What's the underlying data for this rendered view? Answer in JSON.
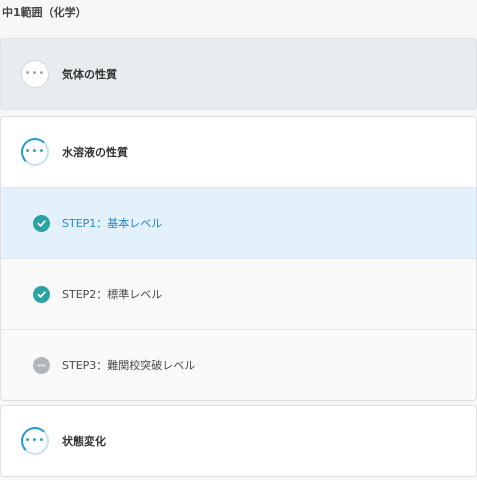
{
  "section_title": "中1範囲（化学）",
  "units": [
    {
      "title": "気体の性質",
      "icon": "more-dots-icon",
      "state": "collapsed"
    },
    {
      "title": "水溶液の性質",
      "icon": "progress-dots-icon",
      "state": "expanded",
      "steps": [
        {
          "label": "STEP1：基本レベル",
          "status": "completed",
          "icon": "check-circle-icon",
          "selected": true
        },
        {
          "label": "STEP2：標準レベル",
          "status": "completed",
          "icon": "check-circle-icon",
          "selected": false
        },
        {
          "label": "STEP3：難関校突破レベル",
          "status": "not-started",
          "icon": "more-dots-icon",
          "selected": false
        }
      ]
    },
    {
      "title": "状態変化",
      "icon": "progress-dots-icon",
      "state": "collapsed"
    }
  ],
  "colors": {
    "accent_blue": "#1f9bcf",
    "completed_teal": "#2aa3a3",
    "selected_background": "#e2f1fc",
    "selected_text": "#2b86c5",
    "pending_grey": "#b2b7ba"
  }
}
